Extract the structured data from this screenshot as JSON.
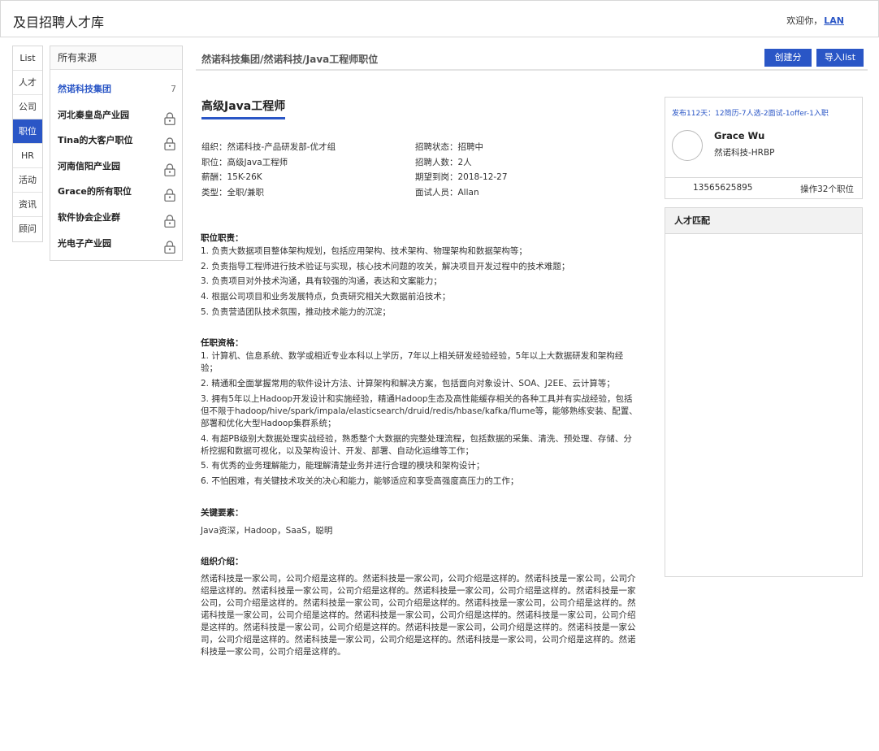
{
  "app": {
    "title": "及目招聘人才库"
  },
  "user": {
    "welcome": "欢迎你，",
    "name": "LAN"
  },
  "nav": {
    "items": [
      {
        "label": "List"
      },
      {
        "label": "人才"
      },
      {
        "label": "公司"
      },
      {
        "label": "职位",
        "active": true
      },
      {
        "label": "HR"
      },
      {
        "label": "活动"
      },
      {
        "label": "资讯"
      },
      {
        "label": "顾问"
      }
    ]
  },
  "sources": {
    "header": "所有来源",
    "items": [
      {
        "label": "然诺科技集团",
        "count": "7",
        "locked": false,
        "active": true
      },
      {
        "label": "河北秦皇岛产业园",
        "locked": true
      },
      {
        "label": "Tina的大客户职位",
        "locked": true
      },
      {
        "label": "河南信阳产业园",
        "locked": true
      },
      {
        "label": "Grace的所有职位",
        "locked": true
      },
      {
        "label": "软件协会企业群",
        "locked": true
      },
      {
        "label": "光电子产业园",
        "locked": true
      }
    ]
  },
  "main": {
    "breadcrumb": "然诺科技集团/然诺科技/Java工程师职位",
    "create_group_label": "创建分组",
    "import_list_label": "导入list"
  },
  "job": {
    "title": "高级Java工程师",
    "info_left": [
      "组织：然诺科技-产品研发部-优才组",
      "职位：高级Java工程师",
      "薪酬：15K-26K",
      "类型：全职/兼职"
    ],
    "info_right": [
      "招聘状态：招聘中",
      "招聘人数：2人",
      "期望到岗：2018-12-27",
      "面试人员：Allan"
    ],
    "duties_title": "职位职责：",
    "duties": [
      "1. 负责大数据项目整体架构规划，包括应用架构、技术架构、物理架构和数据架构等；",
      "2. 负责指导工程师进行技术验证与实现，核心技术问题的攻关，解决项目开发过程中的技术难题；",
      "3. 负责项目对外技术沟通，具有较强的沟通，表达和文案能力；",
      "4. 根据公司项目和业务发展特点，负责研究相关大数据前沿技术；",
      "5. 负责营造团队技术氛围，推动技术能力的沉淀；"
    ],
    "requirements_title": "任职资格：",
    "requirements": [
      "1.  计算机、信息系统、数学或相近专业本科以上学历，7年以上相关研发经验经验，5年以上大数据研发和架构经验；",
      "2.  精通和全面掌握常用的软件设计方法、计算架构和解决方案，包括面向对象设计、SOA、J2EE、云计算等；",
      "3.  拥有5年以上Hadoop开发设计和实施经验，精通Hadoop生态及高性能缓存相关的各种工具并有实战经验，包括但不限于hadoop/hive/spark/impala/elasticsearch/druid/redis/hbase/kafka/flume等，能够熟练安装、配置、部署和优化大型Hadoop集群系统；",
      "4.  有超PB级别大数据处理实战经验，熟悉整个大数据的完整处理流程，包括数据的采集、清洗、预处理、存储、分析挖掘和数据可视化，以及架构设计、开发、部署、自动化运维等工作；",
      "5.  有优秀的业务理解能力，能理解清楚业务并进行合理的模块和架构设计；",
      "6.  不怕困难，有关键技术攻关的决心和能力，能够适应和享受高强度高压力的工作；"
    ],
    "keywords_title": "关键要素：",
    "keywords": "Java资深，Hadoop，SaaS，聪明",
    "org_title": "组织介绍：",
    "org_intro": "然诺科技是一家公司，公司介绍是这样的。然诺科技是一家公司，公司介绍是这样的。然诺科技是一家公司，公司介绍是这样的。然诺科技是一家公司，公司介绍是这样的。然诺科技是一家公司，公司介绍是这样的。然诺科技是一家公司，公司介绍是这样的。然诺科技是一家公司，公司介绍是这样的。然诺科技是一家公司，公司介绍是这样的。然诺科技是一家公司，公司介绍是这样的。然诺科技是一家公司，公司介绍是这样的。然诺科技是一家公司，公司介绍是这样的。然诺科技是一家公司，公司介绍是这样的。然诺科技是一家公司，公司介绍是这样的。然诺科技是一家公司，公司介绍是这样的。然诺科技是一家公司，公司介绍是这样的。然诺科技是一家公司，公司介绍是这样的。然诺科技是一家公司，公司介绍是这样的。"
  },
  "hr_card": {
    "stats": "发布112天：12简历-7人选-2面试-1offer-1入职",
    "name": "Grace Wu",
    "role": "然诺科技-HRBP",
    "phone": "13565625895",
    "operations": "操作32个职位"
  },
  "match": {
    "title": "人才匹配"
  },
  "colors": {
    "accent": "#2a56c6",
    "border": "#d7d7d7"
  }
}
